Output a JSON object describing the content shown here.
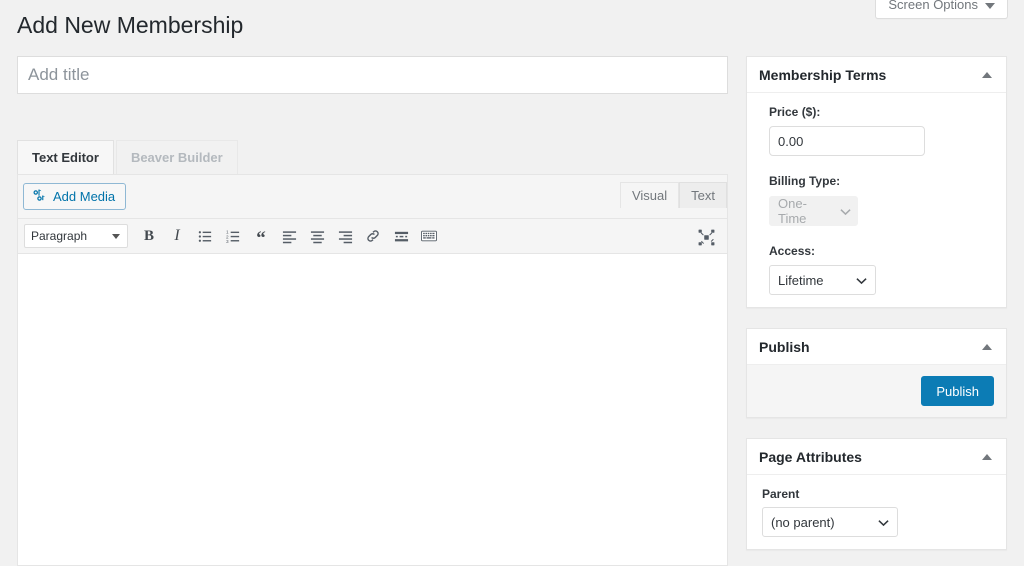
{
  "header": {
    "screen_options_label": "Screen Options",
    "page_title": "Add New Membership"
  },
  "main": {
    "title_placeholder": "Add title",
    "title_value": "",
    "editor_tabs": [
      {
        "label": "Text Editor",
        "active": true
      },
      {
        "label": "Beaver Builder",
        "active": false
      }
    ],
    "add_media_label": "Add Media",
    "mode_tabs": [
      {
        "label": "Visual",
        "active": true
      },
      {
        "label": "Text",
        "active": false
      }
    ],
    "toolbar": {
      "format_value": "Paragraph",
      "buttons": [
        {
          "name": "bold",
          "glyph": "B"
        },
        {
          "name": "italic",
          "glyph": "I"
        },
        {
          "name": "bulleted-list",
          "glyph": ""
        },
        {
          "name": "numbered-list",
          "glyph": ""
        },
        {
          "name": "blockquote",
          "glyph": "“"
        },
        {
          "name": "align-left",
          "glyph": ""
        },
        {
          "name": "align-center",
          "glyph": ""
        },
        {
          "name": "align-right",
          "glyph": ""
        },
        {
          "name": "insert-link",
          "glyph": ""
        },
        {
          "name": "read-more",
          "glyph": ""
        },
        {
          "name": "keyboard-shortcuts",
          "glyph": ""
        }
      ],
      "distraction_free_name": "distraction-free-mode"
    },
    "editor_content": ""
  },
  "sidebar": {
    "membership_terms": {
      "title": "Membership Terms",
      "price_label": "Price ($):",
      "price_value": "0.00",
      "billing_label": "Billing Type:",
      "billing_value": "One-Time",
      "billing_disabled": true,
      "access_label": "Access:",
      "access_value": "Lifetime"
    },
    "publish": {
      "title": "Publish",
      "button_label": "Publish"
    },
    "page_attributes": {
      "title": "Page Attributes",
      "parent_label": "Parent",
      "parent_value": "(no parent)"
    }
  },
  "colors": {
    "accent": "#0c7cb5",
    "link": "#0073aa",
    "page_bg": "#f1f1f1",
    "panel_bg": "#ffffff",
    "text": "#23282d",
    "muted": "#72777c"
  }
}
